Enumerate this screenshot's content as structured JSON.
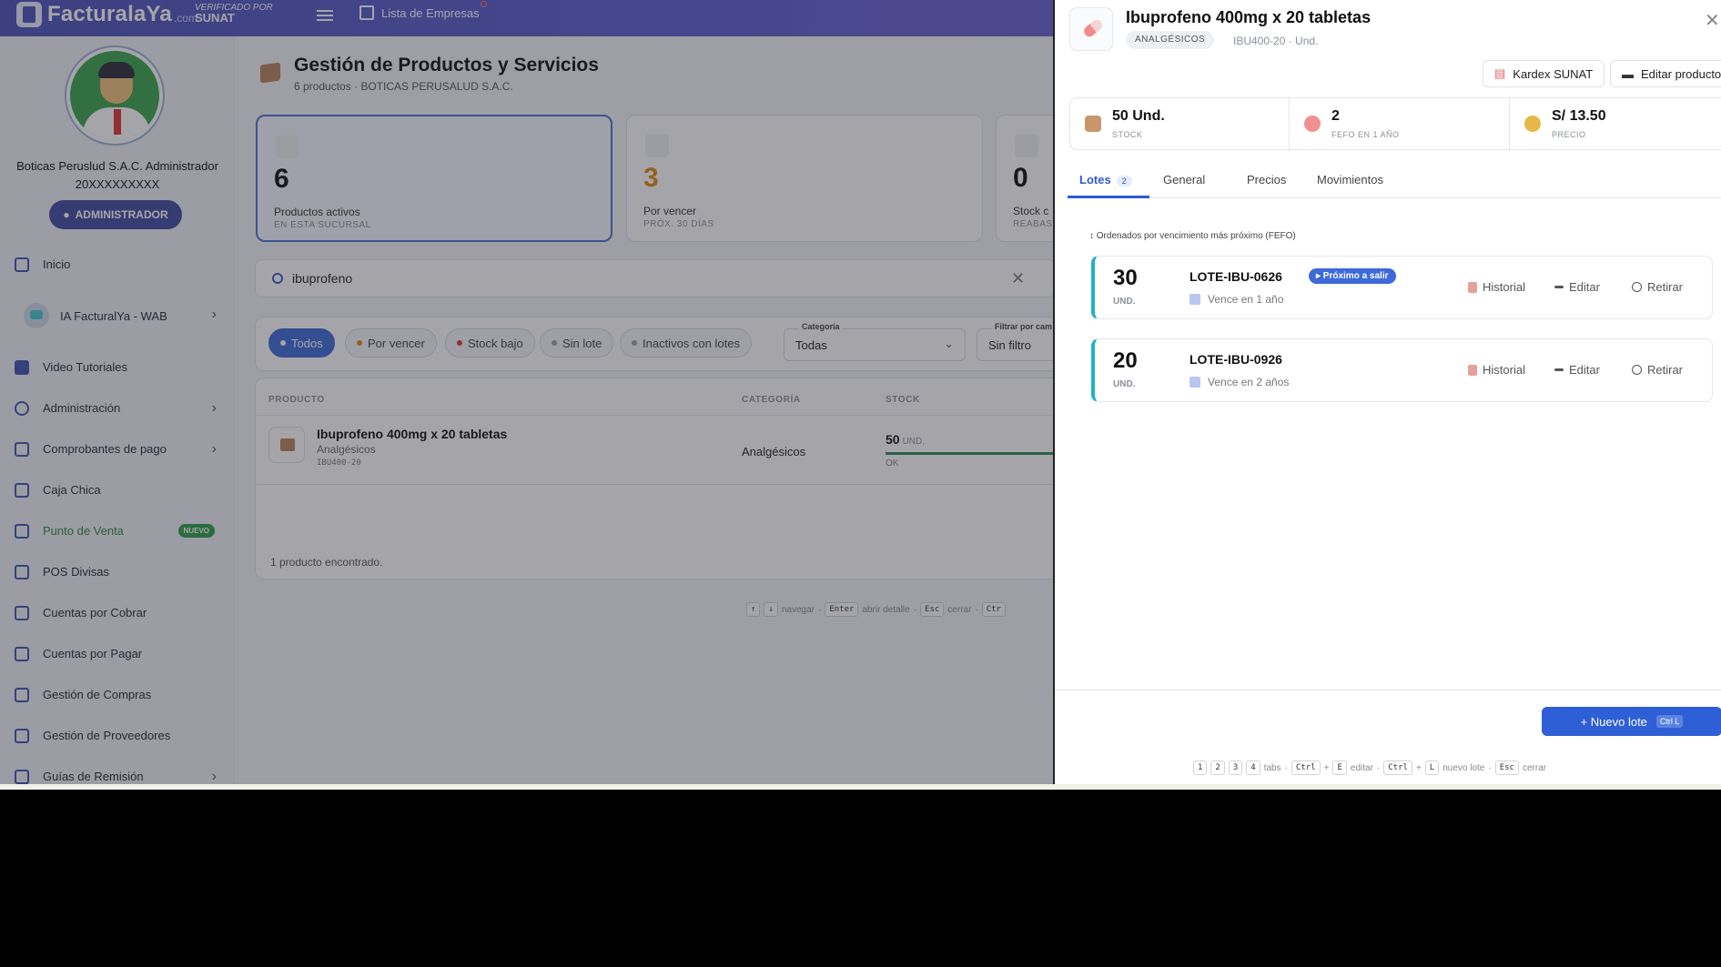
{
  "topbar": {
    "logo_text": "FacturalaYa",
    "logo_suffix": ".com",
    "badge_top": "VERIFICADO POR",
    "badge_bottom": "SUNAT",
    "companies_label": "Lista de Empresas"
  },
  "sidebar": {
    "user_name": "Boticas Peruslud S.A.C. Administrador",
    "user_ruc": "20XXXXXXXXX",
    "role_button": "ADMINISTRADOR",
    "items": [
      {
        "label": "Inicio",
        "icon": "home-icon"
      },
      {
        "label": "IA FacturalYa - WAB",
        "icon": "robot-icon"
      },
      {
        "label": "Video Tutoriales",
        "icon": "video-icon"
      },
      {
        "label": "Administración",
        "icon": "gear-icon"
      },
      {
        "label": "Comprobantes de pago",
        "icon": "receipt-icon"
      },
      {
        "label": "Caja Chica",
        "icon": "calculator-icon"
      },
      {
        "label": "Punto de Venta",
        "icon": "store-icon",
        "badge": "NUEVO"
      },
      {
        "label": "POS Divisas",
        "icon": "store-icon"
      },
      {
        "label": "Cuentas por Cobrar",
        "icon": "cash-icon"
      },
      {
        "label": "Cuentas por Pagar",
        "icon": "card-icon"
      },
      {
        "label": "Gestión de Compras",
        "icon": "bag-icon"
      },
      {
        "label": "Gestión de Proveedores",
        "icon": "store-icon"
      },
      {
        "label": "Guías de Remisión",
        "icon": "truck-icon"
      }
    ]
  },
  "main": {
    "title": "Gestión de Productos y Servicios",
    "subtitle": "6 productos · BOTICAS PERUSALUD S.A.C.",
    "cards": [
      {
        "value": "6",
        "label": "Productos activos",
        "sub": "EN ESTA SUCURSAL"
      },
      {
        "value": "3",
        "label": "Por vencer",
        "sub": "PRÓX. 30 DÍAS"
      },
      {
        "value": "0",
        "label": "Stock c",
        "sub": "REABAS"
      }
    ],
    "search_value": "ibuprofeno",
    "filters": {
      "pills": [
        "Todos",
        "Por vencer",
        "Stock bajo",
        "Sin lote",
        "Inactivos con lotes"
      ],
      "category_label": "Categoría",
      "category_value": "Todas",
      "field_label": "Filtrar por cam",
      "field_value": "Sin filtro"
    },
    "table": {
      "headers": [
        "PRODUCTO",
        "CATEGORÍA",
        "STOCK"
      ],
      "rows": [
        {
          "name": "Ibuprofeno 400mg x 20 tabletas",
          "category_sub": "Analgésicos",
          "code": "IBU400-20",
          "category": "Analgésicos",
          "stock": "50",
          "unit": "UND.",
          "status": "OK"
        }
      ],
      "footer": "1 producto encontrado."
    },
    "hints": {
      "up": "↑",
      "down": "↓",
      "navigate": "navegar",
      "enter": "Enter",
      "open": "abrir detalle",
      "esc": "Esc",
      "close": "cerrar",
      "ctrl": "Ctr"
    }
  },
  "drawer": {
    "title": "Ibuprofeno 400mg x 20 tabletas",
    "category_badge": "ANALGÉSICOS",
    "code": "IBU400-20 · Und.",
    "buttons": {
      "kardex": "Kardex SUNAT",
      "edit": "Editar producto"
    },
    "stats": [
      {
        "value": "50 Und.",
        "label": "STOCK"
      },
      {
        "value": "2",
        "label": "FEFO EN 1 AÑO"
      },
      {
        "value": "S/ 13.50",
        "label": "PRECIO"
      }
    ],
    "tabs": [
      {
        "label": "Lotes",
        "count": "2"
      },
      {
        "label": "General"
      },
      {
        "label": "Precios"
      },
      {
        "label": "Movimientos"
      }
    ],
    "fefo_note": "↕ Ordenados por vencimiento más próximo (FEFO)",
    "lots": [
      {
        "qty": "30",
        "unit": "UND.",
        "name": "LOTE-IBU-0626",
        "badge": "▸ Próximo a salir",
        "expires": "Vence en 1 año"
      },
      {
        "qty": "20",
        "unit": "UND.",
        "name": "LOTE-IBU-0926",
        "expires": "Vence en 2 años"
      }
    ],
    "lot_actions": {
      "history": "Historial",
      "edit": "Editar",
      "remove": "Retirar"
    },
    "new_lot": {
      "label": "+ Nuevo lote",
      "shortcut": "Ctrl L"
    },
    "hints": {
      "k1": "1",
      "k2": "2",
      "k3": "3",
      "k4": "4",
      "tabs": "tabs",
      "ctrl": "Ctrl",
      "plus": "+",
      "e": "E",
      "edit": "editar",
      "l": "L",
      "new_lot": "nuevo lote",
      "esc": "Esc",
      "close": "cerrar"
    }
  }
}
